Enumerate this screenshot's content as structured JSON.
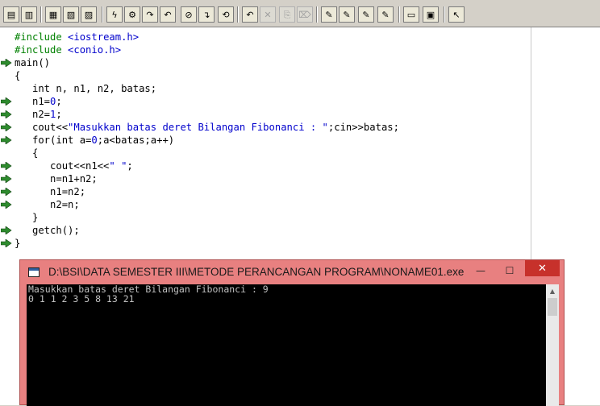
{
  "toolbar": {
    "buttons": [
      {
        "name": "new-file-button",
        "glyph": "▤"
      },
      {
        "name": "open-file-button",
        "glyph": "▥"
      },
      {
        "name": "save-file-button",
        "glyph": "▦"
      },
      {
        "name": "save-all-button",
        "glyph": "▧"
      },
      {
        "name": "print-button",
        "glyph": "▨"
      },
      {
        "name": "compile-button",
        "glyph": "ϟ"
      },
      {
        "name": "make-button",
        "glyph": "⚙"
      },
      {
        "name": "step-over-button",
        "glyph": "↷"
      },
      {
        "name": "trace-into-button",
        "glyph": "↶"
      },
      {
        "name": "run-button",
        "glyph": "⊘"
      },
      {
        "name": "go-to-cursor-button",
        "glyph": "↴"
      },
      {
        "name": "program-reset-button",
        "glyph": "⟲"
      },
      {
        "name": "undo-button",
        "glyph": "↶"
      },
      {
        "name": "cut-button",
        "glyph": "✕"
      },
      {
        "name": "copy-button",
        "glyph": "⎘"
      },
      {
        "name": "paste-button",
        "glyph": "⌦"
      },
      {
        "name": "find-button",
        "glyph": "✎"
      },
      {
        "name": "replace-button",
        "glyph": "✎"
      },
      {
        "name": "search-again-button",
        "glyph": "✎"
      },
      {
        "name": "find-in-files-button",
        "glyph": "✎"
      },
      {
        "name": "window-list-button",
        "glyph": "▭"
      },
      {
        "name": "tile-windows-button",
        "glyph": "▣"
      },
      {
        "name": "help-button",
        "glyph": "↖"
      }
    ]
  },
  "editor": {
    "lines": [
      {
        "text": "#include <iostream.h>",
        "arrow": false
      },
      {
        "text": "#include <conio.h>",
        "arrow": false
      },
      {
        "text": "main()",
        "arrow": true
      },
      {
        "text": "{",
        "arrow": false
      },
      {
        "text": "   int n, n1, n2, batas;",
        "arrow": false
      },
      {
        "text": "   n1=0;",
        "arrow": true
      },
      {
        "text": "   n2=1;",
        "arrow": true
      },
      {
        "text": "   cout<<\"Masukkan batas deret Bilangan Fibonanci : \";cin>>batas;",
        "arrow": true
      },
      {
        "text": "   for(int a=0;a<batas;a++)",
        "arrow": true
      },
      {
        "text": "   {",
        "arrow": false
      },
      {
        "text": "      cout<<n1<<\" \";",
        "arrow": true
      },
      {
        "text": "      n=n1+n2;",
        "arrow": true
      },
      {
        "text": "      n1=n2;",
        "arrow": true
      },
      {
        "text": "      n2=n;",
        "arrow": true
      },
      {
        "text": "   }",
        "arrow": false
      },
      {
        "text": "   getch();",
        "arrow": true
      },
      {
        "text": "}",
        "arrow": true
      }
    ]
  },
  "console": {
    "title": "D:\\BSI\\DATA SEMESTER III\\METODE PERANCANGAN PROGRAM\\NONAME01.exe",
    "minimize_glyph": "—",
    "maximize_glyph": "☐",
    "close_glyph": "✕",
    "output": [
      "Masukkan batas deret Bilangan Fibonanci : 9",
      "0 1 1 2 3 5 8 13 21"
    ]
  },
  "colors": {
    "preprocessor": "#008000",
    "string": "#0000cc",
    "arrow": "#2e8b2e",
    "console_title_bg": "#e88080",
    "close_button": "#c7312b"
  }
}
